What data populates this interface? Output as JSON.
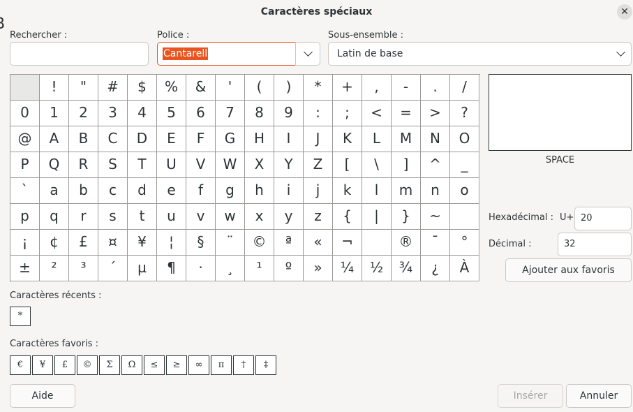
{
  "dialog": {
    "title": "Caractères spéciaux",
    "close_glyph": "✕"
  },
  "search": {
    "label": "Rechercher :",
    "value": ""
  },
  "font": {
    "label": "Police :",
    "value": "Cantarell"
  },
  "subset": {
    "label": "Sous-ensemble :",
    "value": "Latin de base"
  },
  "characters": [
    "",
    "!",
    "\"",
    "#",
    "$",
    "%",
    "&",
    "'",
    "(",
    ")",
    "*",
    "+",
    ",",
    "-",
    ".",
    "/",
    "0",
    "1",
    "2",
    "3",
    "4",
    "5",
    "6",
    "7",
    "8",
    "9",
    ":",
    ";",
    "<",
    "=",
    ">",
    "?",
    "@",
    "A",
    "B",
    "C",
    "D",
    "E",
    "F",
    "G",
    "H",
    "I",
    "J",
    "K",
    "L",
    "M",
    "N",
    "O",
    "P",
    "Q",
    "R",
    "S",
    "T",
    "U",
    "V",
    "W",
    "X",
    "Y",
    "Z",
    "[",
    "\\",
    "]",
    "^",
    "_",
    "`",
    "a",
    "b",
    "c",
    "d",
    "e",
    "f",
    "g",
    "h",
    "i",
    "j",
    "k",
    "l",
    "m",
    "n",
    "o",
    "p",
    "q",
    "r",
    "s",
    "t",
    "u",
    "v",
    "w",
    "x",
    "y",
    "z",
    "{",
    "|",
    "}",
    "~",
    "",
    "¡",
    "¢",
    "£",
    "¤",
    "¥",
    "¦",
    "§",
    "¨",
    "©",
    "ª",
    "«",
    "¬",
    "",
    "®",
    "¯",
    "°",
    "±",
    "²",
    "³",
    "´",
    "µ",
    "¶",
    "·",
    "¸",
    "¹",
    "º",
    "»",
    "¼",
    "½",
    "¾",
    "¿",
    "À"
  ],
  "selected_index": 0,
  "preview": {
    "char": "",
    "name": "SPACE"
  },
  "hex": {
    "label": "Hexadécimal :",
    "prefix": "U+",
    "value": "20"
  },
  "decimal": {
    "label": "Décimal :",
    "value": "32"
  },
  "add_favorites_label": "Ajouter aux favoris",
  "recent": {
    "label": "Caractères récents :",
    "items": [
      "*"
    ]
  },
  "favorites": {
    "label": "Caractères favoris :",
    "items": [
      "€",
      "¥",
      "£",
      "©",
      "Σ",
      "Ω",
      "≤",
      "≥",
      "∞",
      "π",
      "†",
      "‡"
    ]
  },
  "buttons": {
    "help": "Aide",
    "insert": "Insérer",
    "cancel": "Annuler"
  },
  "edge_fragment": "B"
}
